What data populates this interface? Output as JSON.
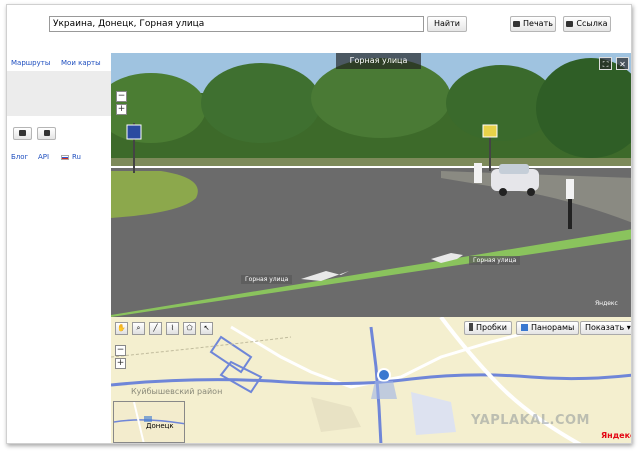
{
  "search": {
    "value": "Украина, Донецк, Горная улица",
    "button": "Найти"
  },
  "header": {
    "print": "Печать",
    "link": "Ссылка"
  },
  "sidebar": {
    "links": [
      "Маршруты",
      "Мои карты"
    ],
    "footer_links": [
      "Блог",
      "API",
      "Ru"
    ]
  },
  "panorama": {
    "title": "Горная улица",
    "street_labels": [
      "Горная улица",
      "Горная улица"
    ],
    "yandex": "Яндекс",
    "zoom_in": "+",
    "zoom_out": "−",
    "close": "✕",
    "fullscreen": "⛶"
  },
  "map": {
    "buttons": [
      "Пробки",
      "Панорамы",
      "Показать ▾"
    ],
    "district": "Куйбышевский район",
    "inset_city": "Донецк",
    "watermark": "YAPLAKAL.COM",
    "yandex_logo": "Яндекс",
    "zoom_in": "+",
    "zoom_out": "−",
    "tool_icons": [
      "hand-icon",
      "magnifier-icon",
      "ruler-icon",
      "route-icon",
      "polygon-icon",
      "pointer-icon"
    ]
  },
  "colors": {
    "link": "#1f4fbf",
    "sky": "#9fc3e0",
    "road": "#6a6a6a",
    "green_line": "#8fd25a",
    "map_bg": "#f4efcf",
    "road_blue": "#6f86d8"
  }
}
